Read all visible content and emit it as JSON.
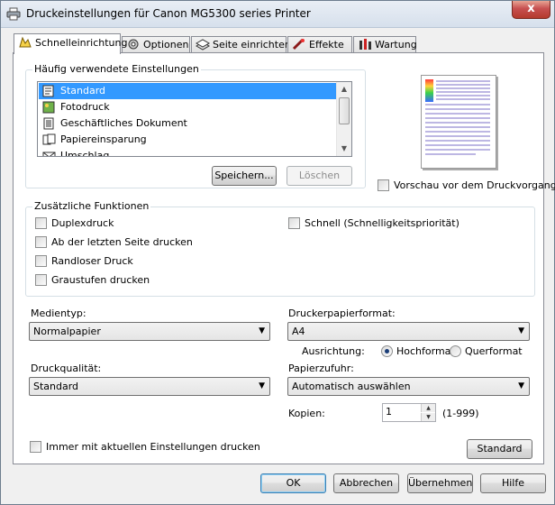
{
  "window": {
    "title": "Druckeinstellungen für Canon MG5300 series Printer",
    "close_label": "x"
  },
  "tabs": [
    {
      "label": "Schnelleinrichtung",
      "icon": "quick-setup-icon",
      "active": true
    },
    {
      "label": "Optionen",
      "icon": "options-icon"
    },
    {
      "label": "Seite einrichten",
      "icon": "page-setup-icon"
    },
    {
      "label": "Effekte",
      "icon": "effects-icon"
    },
    {
      "label": "Wartung",
      "icon": "maintenance-icon"
    }
  ],
  "common_settings": {
    "label": "Häufig verwendete Einstellungen",
    "items": [
      {
        "label": "Standard",
        "icon": "standard-icon",
        "selected": true
      },
      {
        "label": "Fotodruck",
        "icon": "photo-print-icon"
      },
      {
        "label": "Geschäftliches Dokument",
        "icon": "business-document-icon"
      },
      {
        "label": "Papiereinsparung",
        "icon": "paper-saving-icon"
      },
      {
        "label": "Umschlag",
        "icon": "envelope-icon"
      }
    ],
    "save_label": "Speichern...",
    "delete_label": "Löschen"
  },
  "preview_checkbox_label": "Vorschau vor dem Druckvorgang",
  "additional": {
    "label": "Zusätzliche Funktionen",
    "duplex": "Duplexdruck",
    "last_page_first": "Ab der letzten Seite drucken",
    "borderless": "Randloser Druck",
    "grayscale": "Graustufen drucken",
    "fast": "Schnell (Schnelligkeitspriorität)"
  },
  "media": {
    "label": "Medientyp:",
    "value": "Normalpapier"
  },
  "paper_format": {
    "label": "Druckerpapierformat:",
    "value": "A4"
  },
  "orientation": {
    "label": "Ausrichtung:",
    "portrait": "Hochformat",
    "landscape": "Querformat",
    "selected": "portrait"
  },
  "quality": {
    "label": "Druckqualität:",
    "value": "Standard"
  },
  "paper_source": {
    "label": "Papierzufuhr:",
    "value": "Automatisch auswählen"
  },
  "copies": {
    "label": "Kopien:",
    "value": "1",
    "range": "(1-999)"
  },
  "always_print_label": "Immer mit aktuellen Einstellungen drucken",
  "defaults_label": "Standard",
  "footer": {
    "ok": "OK",
    "cancel": "Abbrechen",
    "apply": "Übernehmen",
    "help": "Hilfe"
  }
}
